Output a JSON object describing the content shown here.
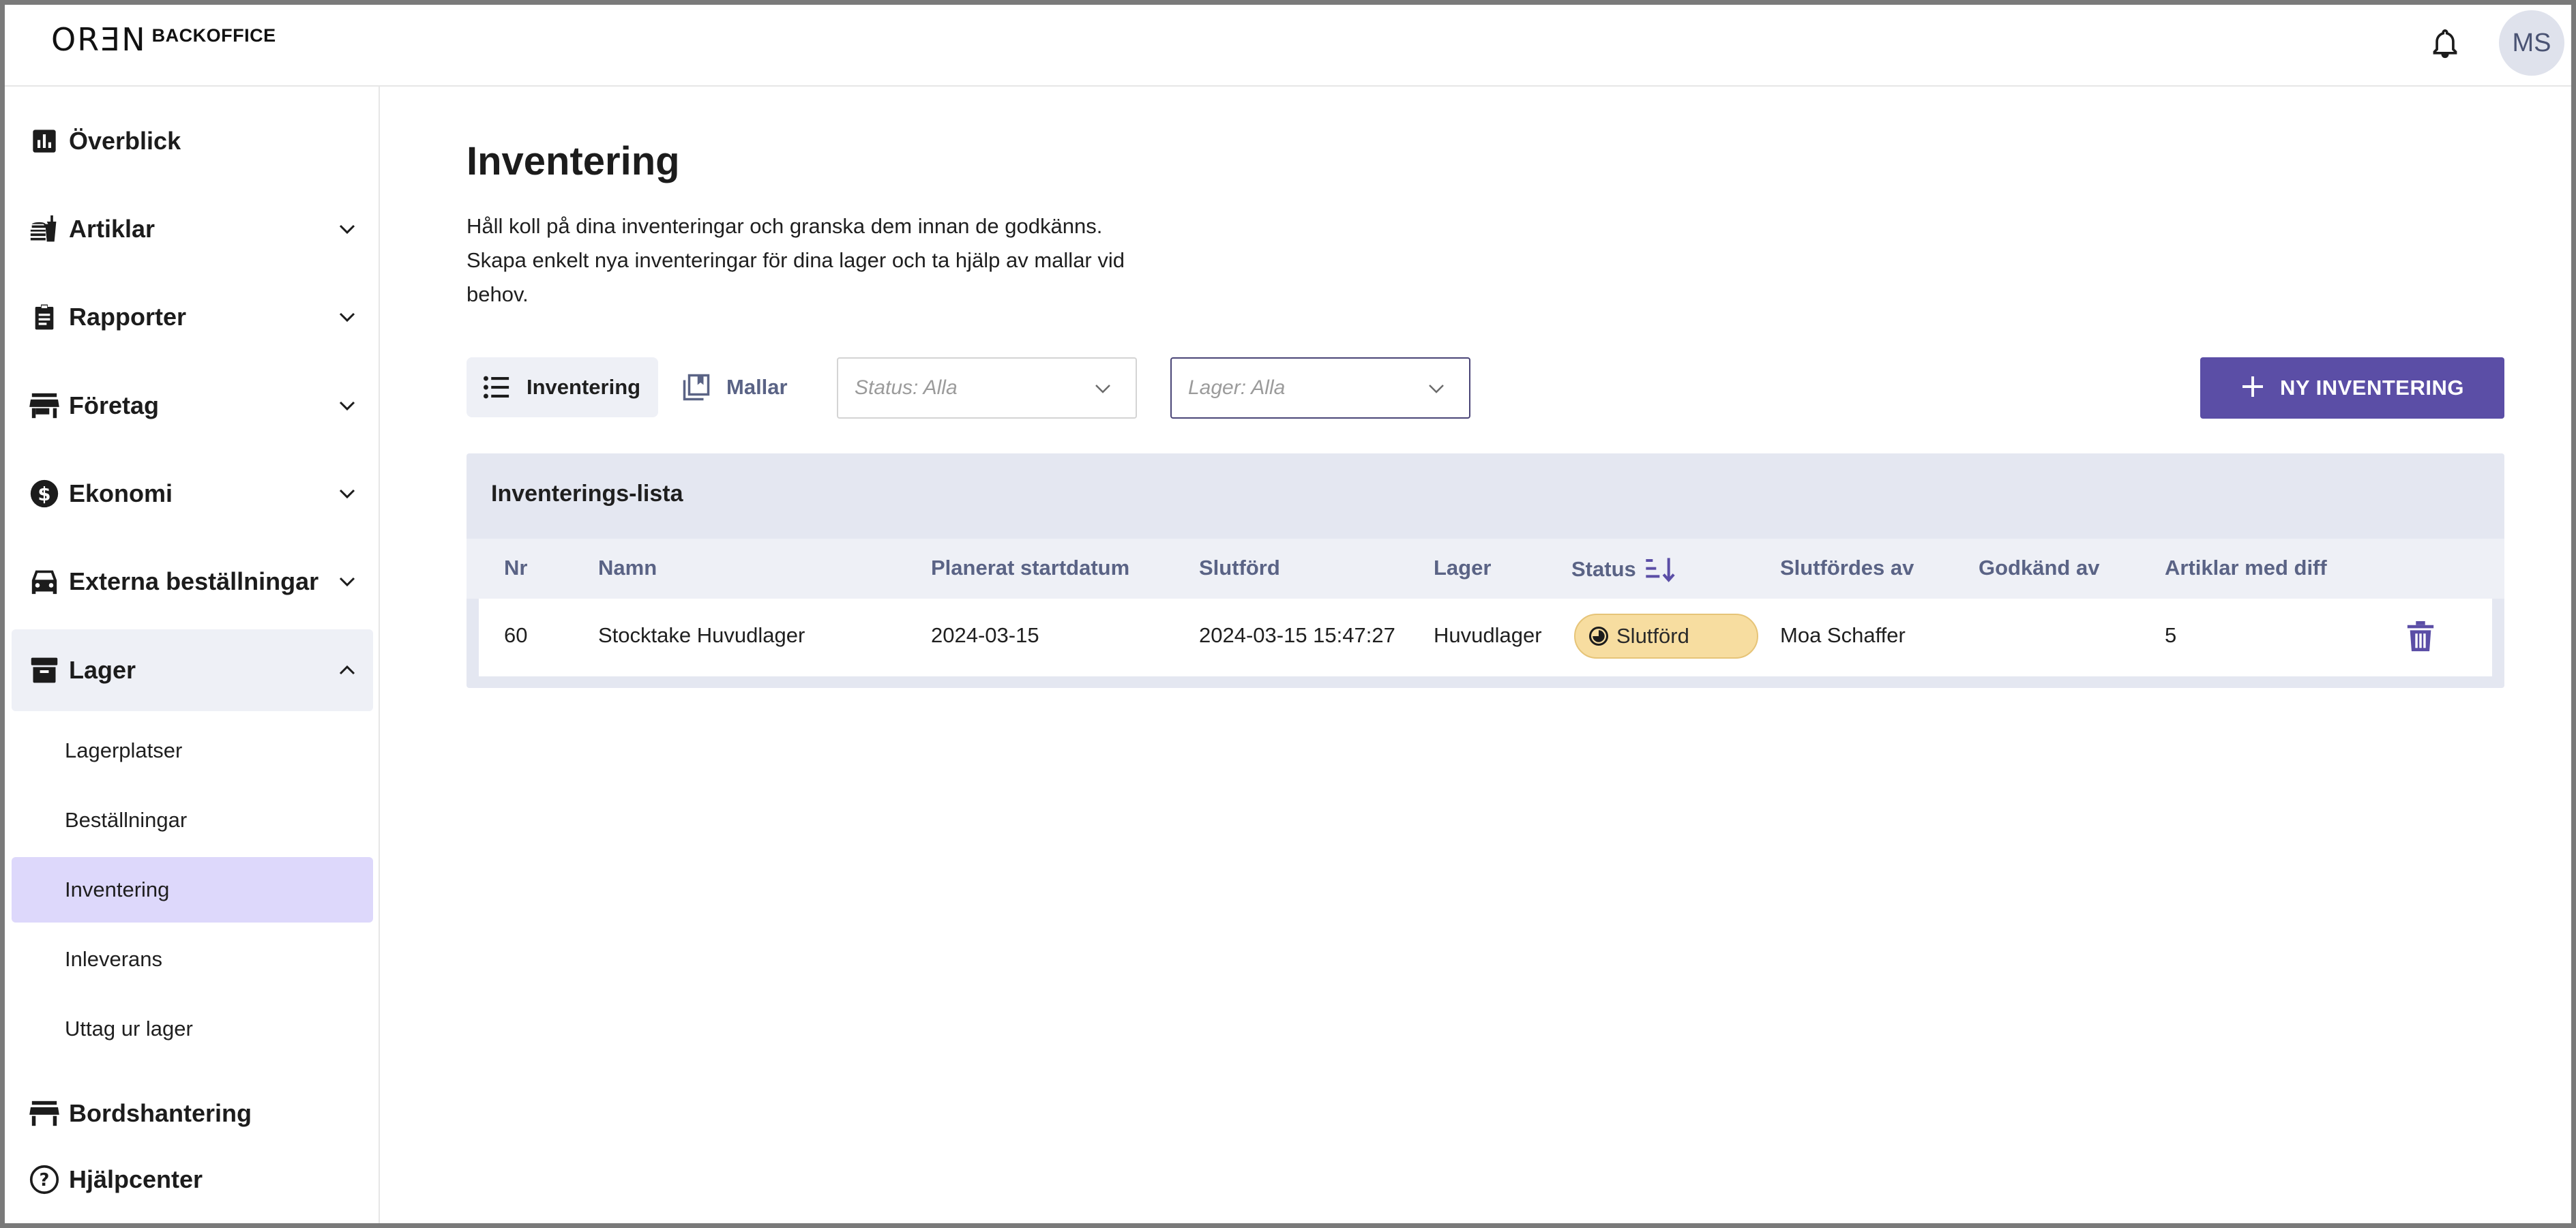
{
  "header": {
    "logo_mark": "ORƎN",
    "logo_text": "BACKOFFICE",
    "avatar_initials": "MS",
    "bell_icon": "bell-icon"
  },
  "sidebar": {
    "items": [
      {
        "label": "Överblick",
        "icon": "bar-chart-icon"
      },
      {
        "label": "Artiklar",
        "icon": "food-icon"
      },
      {
        "label": "Rapporter",
        "icon": "clipboard-icon"
      },
      {
        "label": "Företag",
        "icon": "store-icon"
      },
      {
        "label": "Ekonomi",
        "icon": "dollar-icon"
      },
      {
        "label": "Externa beställningar",
        "icon": "car-icon"
      },
      {
        "label": "Lager",
        "icon": "archive-icon"
      },
      {
        "label": "Bordshantering",
        "icon": "table-icon"
      },
      {
        "label": "Hjälpcenter",
        "icon": "help-icon"
      }
    ],
    "lager_sub": [
      {
        "label": "Lagerplatser"
      },
      {
        "label": "Beställningar"
      },
      {
        "label": "Inventering"
      },
      {
        "label": "Inleverans"
      },
      {
        "label": "Uttag ur lager"
      }
    ]
  },
  "main": {
    "title": "Inventering",
    "description": "Håll koll på dina inventeringar och granska dem innan de godkänns. Skapa enkelt nya inventeringar för dina lager och ta hjälp av mallar vid behov.",
    "tabs": [
      {
        "label": "Inventering",
        "icon": "list-icon"
      },
      {
        "label": "Mallar",
        "icon": "templates-icon"
      }
    ],
    "filters": {
      "status_placeholder": "Status: Alla",
      "lager_placeholder": "Lager: Alla"
    },
    "new_button_label": "NY INVENTERING",
    "table": {
      "title": "Inventerings-lista",
      "columns": [
        "Nr",
        "Namn",
        "Planerat startdatum",
        "Slutförd",
        "Lager",
        "Status",
        "Slutfördes av",
        "Godkänd av",
        "Artiklar med diff"
      ],
      "rows": [
        {
          "nr": "60",
          "namn": "Stocktake Huvudlager",
          "planerat": "2024-03-15",
          "slutford": "2024-03-15 15:47:27",
          "lager": "Huvudlager",
          "status": "Slutförd",
          "slutfordes_av": "Moa Schaffer",
          "godkand_av": "",
          "artiklar_diff": "5"
        }
      ]
    }
  },
  "colors": {
    "accent": "#5b4ea6",
    "active_nav": "#ddd8fb",
    "status_badge": "#f7dda0",
    "table_header_bg": "#e4e7f1"
  }
}
